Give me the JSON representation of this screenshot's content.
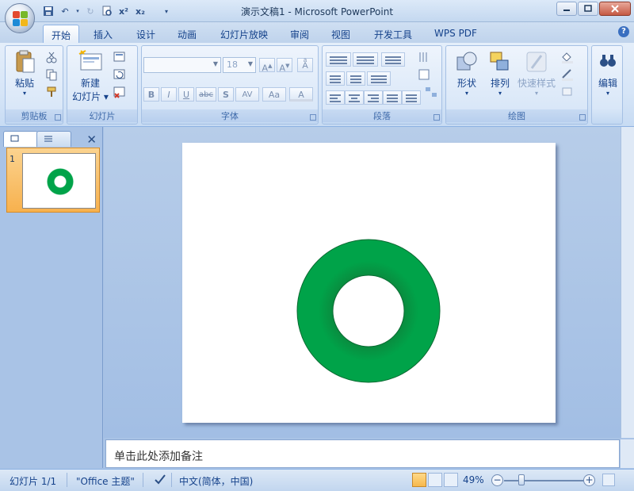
{
  "window": {
    "title": "演示文稿1 - Microsoft PowerPoint"
  },
  "tabs": [
    "开始",
    "插入",
    "设计",
    "动画",
    "幻灯片放映",
    "审阅",
    "视图",
    "开发工具",
    "WPS PDF"
  ],
  "ribbon": {
    "clipboard": {
      "label": "剪贴板",
      "paste": "粘贴"
    },
    "slides": {
      "label": "幻灯片",
      "new_slide_line1": "新建",
      "new_slide_line2": "幻灯片"
    },
    "font": {
      "label": "字体",
      "font_size": "18",
      "buttons": [
        "B",
        "I",
        "U",
        "abc",
        "S",
        "AV",
        "Aa",
        "A"
      ]
    },
    "paragraph": {
      "label": "段落"
    },
    "drawing": {
      "label": "绘图",
      "shapes": "形状",
      "arrange": "排列",
      "quick_styles": "快速样式"
    },
    "editing": {
      "label": "编辑"
    }
  },
  "slides_pane": {
    "slide_number": "1"
  },
  "notes": {
    "placeholder": "单击此处添加备注"
  },
  "statusbar": {
    "slide_info": "幻灯片 1/1",
    "theme": "\"Office 主题\"",
    "language": "中文(简体，中国)",
    "zoom": "49%"
  },
  "slide_content": {
    "shape": "donut",
    "fill_color": "#00a349",
    "fill_color_dark": "#0a8a3e"
  }
}
